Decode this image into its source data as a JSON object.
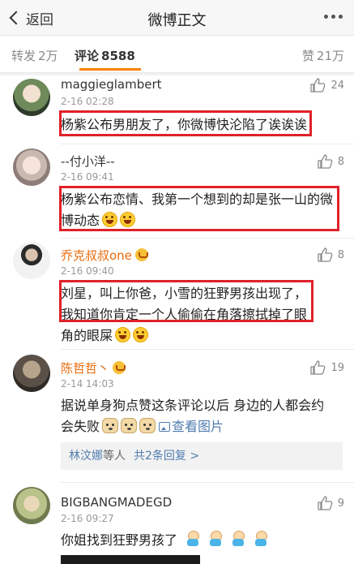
{
  "header": {
    "back_label": "返回",
    "title": "微博正文"
  },
  "tabs": {
    "repost_label": "转发",
    "repost_count": "2万",
    "comment_label": "评论",
    "comment_count": "8588",
    "like_label": "赞",
    "like_count": "21万"
  },
  "comments": [
    {
      "user": "maggieglambert",
      "time": "2-16 02:28",
      "likes": "24",
      "text": "杨紫公布男朋友了，你微博快沦陷了诶诶诶"
    },
    {
      "user": "--付小洋--",
      "time": "2-16 09:41",
      "likes": "8",
      "text": "杨紫公布恋情、我第一个想到的却是张一山的微博动态"
    },
    {
      "user": "乔克叔叔one",
      "time": "2-16 09:40",
      "likes": "8",
      "text": "刘星，叫上你爸，小雪的狂野男孩出现了，我知道你肯定一个人偷偷在角落擦拭掉了眼角的眼屎"
    },
    {
      "user": "陈哲哲丶",
      "time": "2-14 14:03",
      "likes": "19",
      "text": "据说单身狗点赞这条评论以后 身边的人都会约会失败",
      "pic_link": "查看图片",
      "reply": {
        "users": "林汶娜",
        "suffix": "等人",
        "count": "共2条回复 >"
      }
    },
    {
      "user": "BIGBANGMADEGD",
      "time": "2-16 09:27",
      "likes": "9",
      "text": "你姐找到狂野男孩了"
    }
  ],
  "colors": {
    "accent": "#ff8200",
    "highlight_box": "#e0212a",
    "link": "#507daf",
    "vip_name": "#e86b0c"
  }
}
